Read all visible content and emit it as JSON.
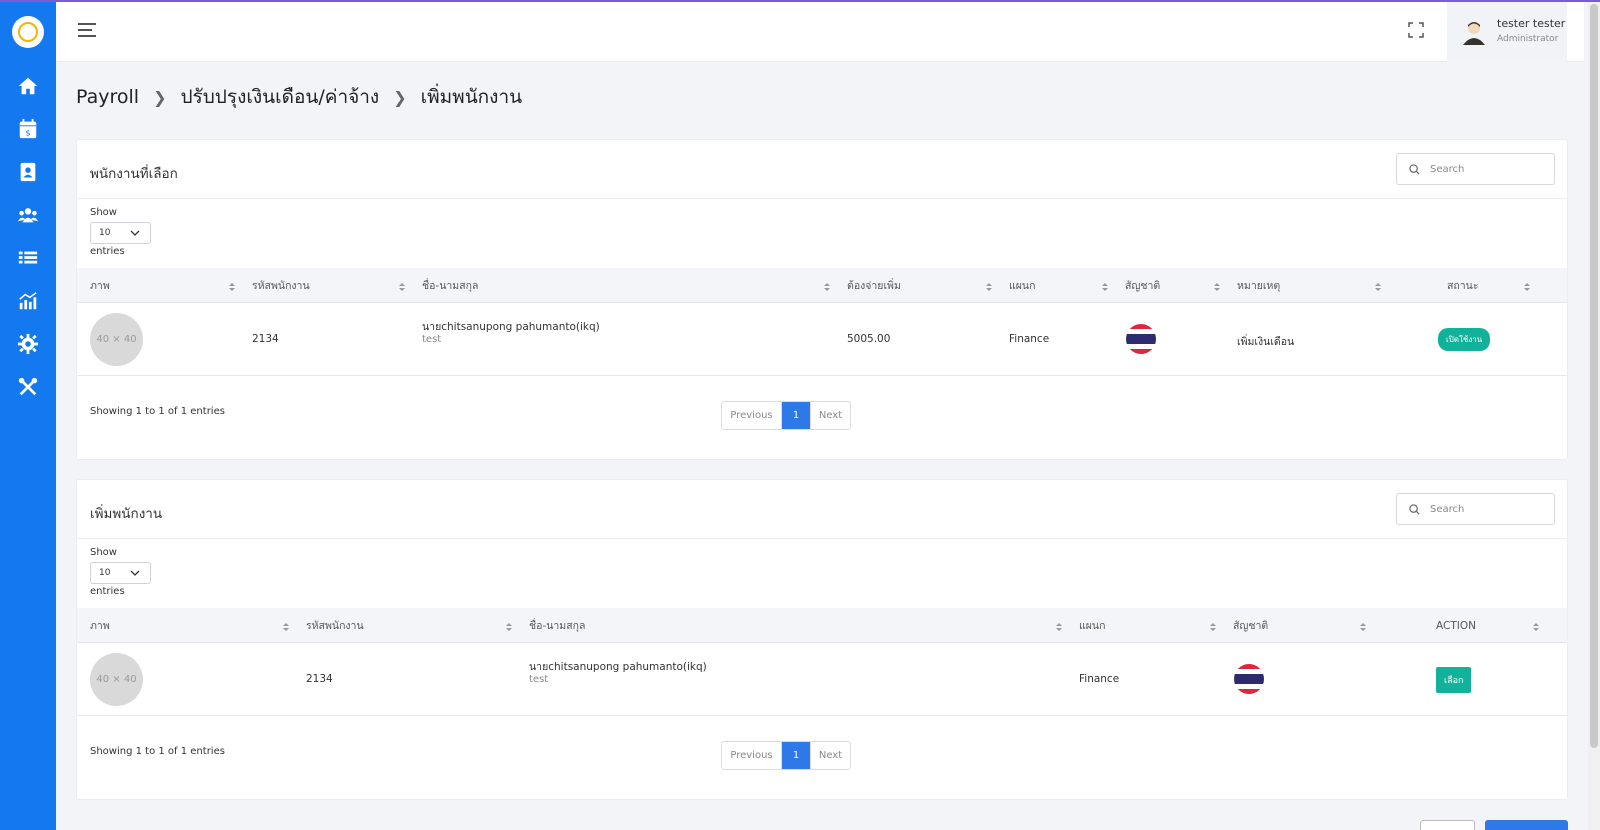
{
  "header": {
    "user_name": "tester tester",
    "user_role": "Administrator"
  },
  "breadcrumb": [
    "Payroll",
    "ปรับปรุงเงินเดือน/ค่าจ้าง",
    "เพิ่มพนักงาน"
  ],
  "selected_panel": {
    "title": "พนักงานที่เลือก",
    "search_placeholder": "Search",
    "show_label": "Show",
    "entries_value": "10",
    "entries_label": "entries",
    "columns": [
      "ภาพ",
      "รหัสพนักงาน",
      "ชื่อ-นามสกุล",
      "ต้องจ่ายเพิ่ม",
      "แผนก",
      "สัญชาติ",
      "หมายเหตุ",
      "สถานะ"
    ],
    "row": {
      "photo": "40 × 40",
      "code": "2134",
      "name": "นายchitsanupong pahumanto(ikq)",
      "nickname": "test",
      "amount": "5005.00",
      "department": "Finance",
      "note": "เพิ่มเงินเดือน",
      "status": "เปิดใช้งาน"
    },
    "info": "Showing 1 to 1 of 1 entries",
    "pager": {
      "previous": "Previous",
      "page": "1",
      "next": "Next"
    }
  },
  "add_panel": {
    "title": "เพิ่มพนักงาน",
    "search_placeholder": "Search",
    "show_label": "Show",
    "entries_value": "10",
    "entries_label": "entries",
    "columns": [
      "ภาพ",
      "รหัสพนักงาน",
      "ชื่อ-นามสกุล",
      "แผนก",
      "สัญชาติ",
      "ACTION"
    ],
    "row": {
      "photo": "40 × 40",
      "code": "2134",
      "name": "นายchitsanupong pahumanto(ikq)",
      "nickname": "test",
      "department": "Finance",
      "action": "เลือก"
    },
    "info": "Showing 1 to 1 of 1 entries",
    "pager": {
      "previous": "Previous",
      "page": "1",
      "next": "Next"
    }
  },
  "colors": {
    "sidebar": "#1479ee",
    "accent": "#2e79e8",
    "success": "#12b29a"
  },
  "icons": [
    "logo-icon",
    "home-icon",
    "payroll-calendar-icon",
    "employee-card-icon",
    "team-icon",
    "list-icon",
    "chart-icon",
    "settings-icon",
    "tools-icon",
    "menu-icon",
    "fullscreen-icon",
    "user-avatar-icon",
    "search-icon",
    "thai-flag-icon"
  ]
}
